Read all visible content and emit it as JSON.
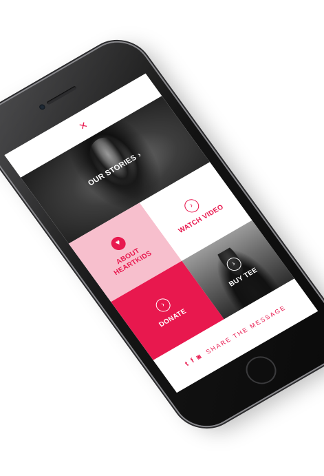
{
  "header": {
    "close_icon": "×"
  },
  "banner": {
    "label": "OUR STORIES",
    "chevron": "›"
  },
  "tiles": {
    "watch_video": {
      "label": "WATCH VIDEO",
      "icon": "›"
    },
    "about": {
      "label": "ABOUT\nHEARTKIDS",
      "icon": "♥"
    },
    "buy_tee": {
      "label": "BUY TEE",
      "icon": "›"
    },
    "donate": {
      "label": "DONATE",
      "icon": "›"
    }
  },
  "share": {
    "twitter_icon": "t",
    "facebook_icon": "f",
    "instagram_icon": "◙",
    "label": "SHARE THE MESSAGE"
  },
  "colors": {
    "accent": "#e8184e",
    "pink": "#f7bfcd"
  }
}
